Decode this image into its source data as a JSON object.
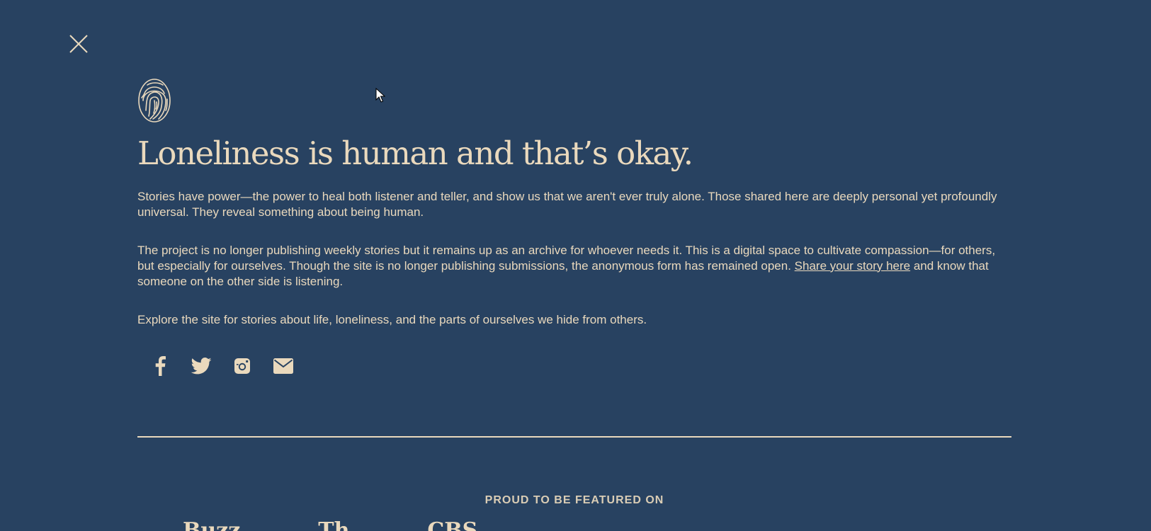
{
  "close": {
    "icon": "close-icon"
  },
  "logo": {
    "icon": "fingerprint-icon"
  },
  "heading": "Loneliness is human and that’s okay.",
  "paragraph1": "Stories have power—the power to heal both listener and teller, and show us that we aren't ever truly alone. Those shared here are deeply personal yet profoundly universal. They reveal something about being human.",
  "paragraph2": {
    "before": "The project is no longer publishing weekly stories but it remains up as an archive for whoever needs it. This is a digital space to cultivate compassion—for others, but especially for ourselves. Though the site is no longer publishing submissions, the anonymous form has remained open. ",
    "link": "Share your story here",
    "after": " and know that someone on the other side is listening."
  },
  "paragraph3": "Explore the site for stories about life, loneliness, and the parts of ourselves we hide from others.",
  "social": [
    {
      "icon": "facebook-icon"
    },
    {
      "icon": "twitter-icon"
    },
    {
      "icon": "instagram-icon"
    },
    {
      "icon": "email-icon"
    }
  ],
  "featured": {
    "label": "PROUD TO BE FEATURED ON",
    "logos": [
      "Buzz",
      "Th",
      "CBS"
    ]
  },
  "colors": {
    "background": "#284261",
    "text": "#ead9bd"
  }
}
